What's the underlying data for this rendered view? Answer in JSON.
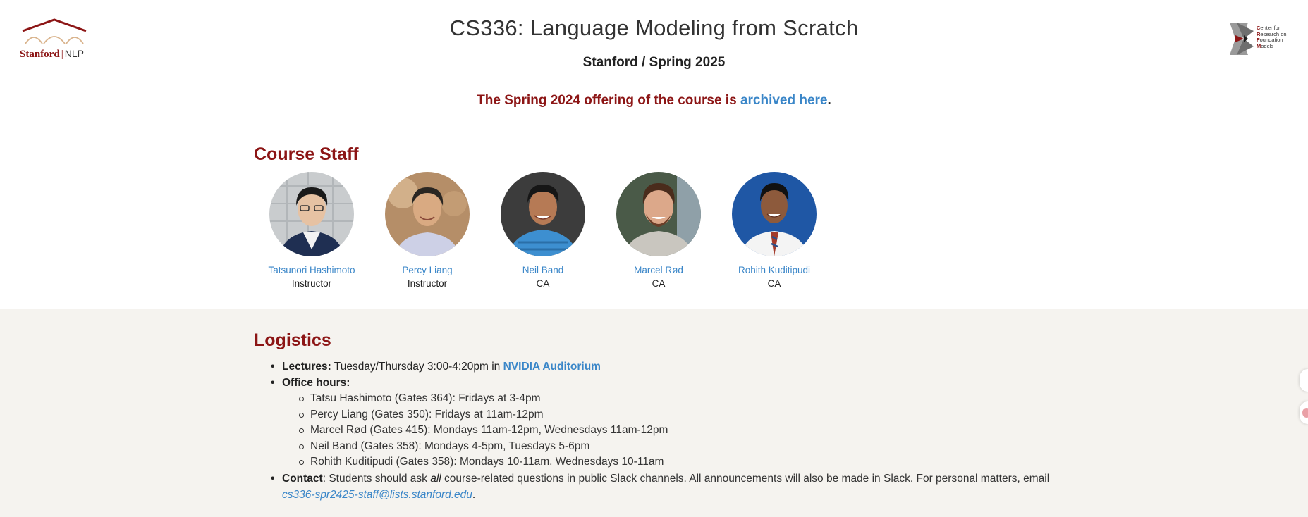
{
  "header": {
    "title": "CS336: Language Modeling from Scratch",
    "subtitle": "Stanford / Spring 2025",
    "notice_prefix": "The Spring 2024 offering of the course is ",
    "notice_link": "archived here",
    "notice_suffix": "."
  },
  "logos": {
    "left": {
      "wordmark": "Stanford",
      "divider": "|",
      "suffix": "NLP"
    },
    "right": {
      "lines": [
        {
          "first": "C",
          "rest": "enter for"
        },
        {
          "first": "R",
          "rest": "esearch on"
        },
        {
          "first": "F",
          "rest": "oundation"
        },
        {
          "first": "M",
          "rest": "odels"
        }
      ]
    }
  },
  "staff_section": {
    "heading": "Course Staff",
    "members": [
      {
        "name": "Tatsunori Hashimoto",
        "role": "Instructor"
      },
      {
        "name": "Percy Liang",
        "role": "Instructor"
      },
      {
        "name": "Neil Band",
        "role": "CA"
      },
      {
        "name": "Marcel Rød",
        "role": "CA"
      },
      {
        "name": "Rohith Kuditipudi",
        "role": "CA"
      }
    ]
  },
  "logistics": {
    "heading": "Logistics",
    "lectures_label": "Lectures:",
    "lectures_text": " Tuesday/Thursday 3:00-4:20pm in ",
    "lectures_location": "NVIDIA Auditorium",
    "office_hours_label": "Office hours:",
    "office_hours": [
      "Tatsu Hashimoto (Gates 364): Fridays at 3-4pm",
      "Percy Liang (Gates 350): Fridays at 11am-12pm",
      "Marcel Rød (Gates 415): Mondays 11am-12pm, Wednesdays 11am-12pm",
      "Neil Band (Gates 358): Mondays 4-5pm, Tuesdays 5-6pm",
      "Rohith Kuditipudi (Gates 358): Mondays 10-11am, Wednesdays 10-11am"
    ],
    "contact_label": "Contact",
    "contact_text_1": ": Students should ask ",
    "contact_emphasis": "all",
    "contact_text_2": " course-related questions in public Slack channels. All announcements will also be made in Slack. For personal matters, email",
    "contact_email": "cs336-spr2425-staff@lists.stanford.edu",
    "contact_end": "."
  },
  "colors": {
    "cardinal": "#8c1515",
    "link": "#3a86c8",
    "logistics_bg": "#f5f3ef"
  }
}
